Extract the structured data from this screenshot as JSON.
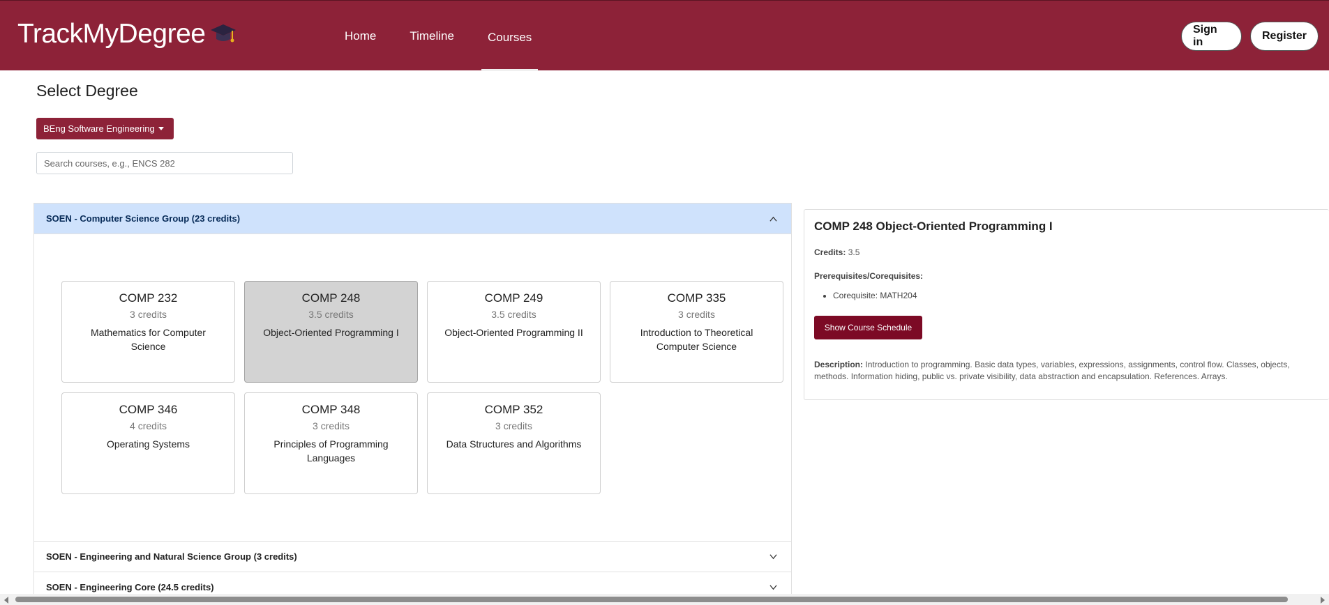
{
  "header": {
    "brand": "TrackMyDegree",
    "brand_icon": "graduation-cap-icon",
    "nav": [
      {
        "label": "Home"
      },
      {
        "label": "Timeline"
      },
      {
        "label": "Courses",
        "active": true
      }
    ],
    "sign_in": "Sign in",
    "register": "Register",
    "accent_color": "#8d2238"
  },
  "degree": {
    "title": "Select Degree",
    "selected": "BEng Software Engineering",
    "search_placeholder": "Search courses, e.g., ENCS 282"
  },
  "groups": [
    {
      "title": "SOEN - Computer Science Group (23 credits)",
      "expanded": true,
      "courses": [
        {
          "code": "COMP 232",
          "credits": "3 credits",
          "name": "Mathematics for Computer Science"
        },
        {
          "code": "COMP 248",
          "credits": "3.5 credits",
          "name": "Object-Oriented Programming I",
          "selected": true
        },
        {
          "code": "COMP 249",
          "credits": "3.5 credits",
          "name": "Object-Oriented Programming II"
        },
        {
          "code": "COMP 335",
          "credits": "3 credits",
          "name": "Introduction to Theoretical Computer Science"
        },
        {
          "code": "COMP 346",
          "credits": "4 credits",
          "name": "Operating Systems"
        },
        {
          "code": "COMP 348",
          "credits": "3 credits",
          "name": "Principles of Programming Languages"
        },
        {
          "code": "COMP 352",
          "credits": "3 credits",
          "name": "Data Structures and Algorithms"
        }
      ]
    },
    {
      "title": "SOEN - Engineering and Natural Science Group (3 credits)",
      "expanded": false
    },
    {
      "title": "SOEN - Engineering Core (24.5 credits)",
      "expanded": false
    }
  ],
  "detail": {
    "title": "COMP 248 Object-Oriented Programming I",
    "credits_label": "Credits:",
    "credits_value": "3.5",
    "prereq_label": "Prerequisites/Corequisites:",
    "prereqs": [
      "Corequisite: MATH204"
    ],
    "schedule_button": "Show Course Schedule",
    "description_label": "Description:",
    "description": "Introduction to programming. Basic data types, variables, expressions, assignments, control flow. Classes, objects, methods. Information hiding, public vs. private visibility, data abstraction and encapsulation. References. Arrays."
  }
}
